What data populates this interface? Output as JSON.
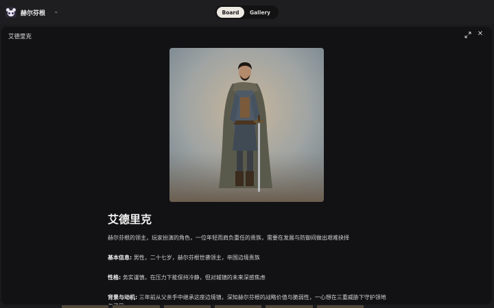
{
  "header": {
    "brand_name": "赫尔芬根",
    "toggle": {
      "active": "Board",
      "inactive": "Gallery"
    }
  },
  "modal": {
    "title": "艾德里克",
    "character": {
      "name": "艾德里克",
      "summary": "赫尔芬根的领主，玩家扮演的角色，一位年轻而肩负重任的贵族，需要在发展与防御间做出艰难抉择",
      "sections": [
        {
          "label": "基本信息:",
          "text": " 男性，二十七岁，赫尔芬根世袭领主，帝国边境贵族"
        },
        {
          "label": "性格:",
          "text": " 务实谨慎，在压力下能保持冷静，但对城镇的未来深感焦虑"
        },
        {
          "label": "背景与动机:",
          "text": " 三年前从父亲手中继承这座边境镇，深知赫尔芬根的战略价值与脆弱性，一心想在三重威胁下守护领地与子民"
        }
      ]
    }
  },
  "colors": {
    "background": "#1b1b1d",
    "modal": "#121214",
    "toggle_active": "#ece9e3"
  }
}
